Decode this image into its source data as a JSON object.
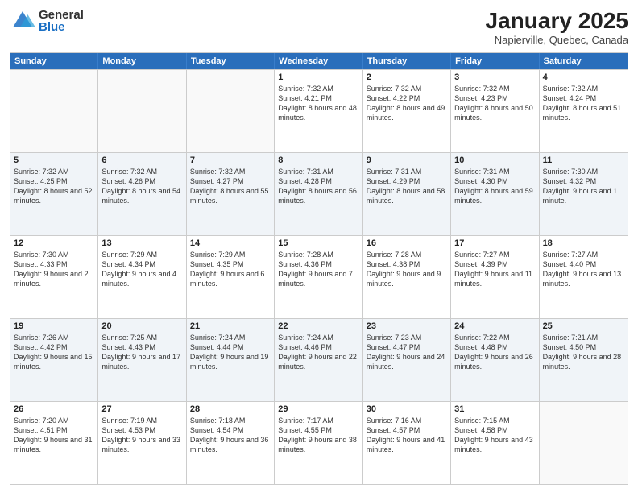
{
  "header": {
    "logo_general": "General",
    "logo_blue": "Blue",
    "month_title": "January 2025",
    "location": "Napierville, Quebec, Canada"
  },
  "days_of_week": [
    "Sunday",
    "Monday",
    "Tuesday",
    "Wednesday",
    "Thursday",
    "Friday",
    "Saturday"
  ],
  "weeks": [
    {
      "cells": [
        {
          "day": "",
          "sunrise": "",
          "sunset": "",
          "daylight": ""
        },
        {
          "day": "",
          "sunrise": "",
          "sunset": "",
          "daylight": ""
        },
        {
          "day": "",
          "sunrise": "",
          "sunset": "",
          "daylight": ""
        },
        {
          "day": "1",
          "sunrise": "Sunrise: 7:32 AM",
          "sunset": "Sunset: 4:21 PM",
          "daylight": "Daylight: 8 hours and 48 minutes."
        },
        {
          "day": "2",
          "sunrise": "Sunrise: 7:32 AM",
          "sunset": "Sunset: 4:22 PM",
          "daylight": "Daylight: 8 hours and 49 minutes."
        },
        {
          "day": "3",
          "sunrise": "Sunrise: 7:32 AM",
          "sunset": "Sunset: 4:23 PM",
          "daylight": "Daylight: 8 hours and 50 minutes."
        },
        {
          "day": "4",
          "sunrise": "Sunrise: 7:32 AM",
          "sunset": "Sunset: 4:24 PM",
          "daylight": "Daylight: 8 hours and 51 minutes."
        }
      ]
    },
    {
      "cells": [
        {
          "day": "5",
          "sunrise": "Sunrise: 7:32 AM",
          "sunset": "Sunset: 4:25 PM",
          "daylight": "Daylight: 8 hours and 52 minutes."
        },
        {
          "day": "6",
          "sunrise": "Sunrise: 7:32 AM",
          "sunset": "Sunset: 4:26 PM",
          "daylight": "Daylight: 8 hours and 54 minutes."
        },
        {
          "day": "7",
          "sunrise": "Sunrise: 7:32 AM",
          "sunset": "Sunset: 4:27 PM",
          "daylight": "Daylight: 8 hours and 55 minutes."
        },
        {
          "day": "8",
          "sunrise": "Sunrise: 7:31 AM",
          "sunset": "Sunset: 4:28 PM",
          "daylight": "Daylight: 8 hours and 56 minutes."
        },
        {
          "day": "9",
          "sunrise": "Sunrise: 7:31 AM",
          "sunset": "Sunset: 4:29 PM",
          "daylight": "Daylight: 8 hours and 58 minutes."
        },
        {
          "day": "10",
          "sunrise": "Sunrise: 7:31 AM",
          "sunset": "Sunset: 4:30 PM",
          "daylight": "Daylight: 8 hours and 59 minutes."
        },
        {
          "day": "11",
          "sunrise": "Sunrise: 7:30 AM",
          "sunset": "Sunset: 4:32 PM",
          "daylight": "Daylight: 9 hours and 1 minute."
        }
      ]
    },
    {
      "cells": [
        {
          "day": "12",
          "sunrise": "Sunrise: 7:30 AM",
          "sunset": "Sunset: 4:33 PM",
          "daylight": "Daylight: 9 hours and 2 minutes."
        },
        {
          "day": "13",
          "sunrise": "Sunrise: 7:29 AM",
          "sunset": "Sunset: 4:34 PM",
          "daylight": "Daylight: 9 hours and 4 minutes."
        },
        {
          "day": "14",
          "sunrise": "Sunrise: 7:29 AM",
          "sunset": "Sunset: 4:35 PM",
          "daylight": "Daylight: 9 hours and 6 minutes."
        },
        {
          "day": "15",
          "sunrise": "Sunrise: 7:28 AM",
          "sunset": "Sunset: 4:36 PM",
          "daylight": "Daylight: 9 hours and 7 minutes."
        },
        {
          "day": "16",
          "sunrise": "Sunrise: 7:28 AM",
          "sunset": "Sunset: 4:38 PM",
          "daylight": "Daylight: 9 hours and 9 minutes."
        },
        {
          "day": "17",
          "sunrise": "Sunrise: 7:27 AM",
          "sunset": "Sunset: 4:39 PM",
          "daylight": "Daylight: 9 hours and 11 minutes."
        },
        {
          "day": "18",
          "sunrise": "Sunrise: 7:27 AM",
          "sunset": "Sunset: 4:40 PM",
          "daylight": "Daylight: 9 hours and 13 minutes."
        }
      ]
    },
    {
      "cells": [
        {
          "day": "19",
          "sunrise": "Sunrise: 7:26 AM",
          "sunset": "Sunset: 4:42 PM",
          "daylight": "Daylight: 9 hours and 15 minutes."
        },
        {
          "day": "20",
          "sunrise": "Sunrise: 7:25 AM",
          "sunset": "Sunset: 4:43 PM",
          "daylight": "Daylight: 9 hours and 17 minutes."
        },
        {
          "day": "21",
          "sunrise": "Sunrise: 7:24 AM",
          "sunset": "Sunset: 4:44 PM",
          "daylight": "Daylight: 9 hours and 19 minutes."
        },
        {
          "day": "22",
          "sunrise": "Sunrise: 7:24 AM",
          "sunset": "Sunset: 4:46 PM",
          "daylight": "Daylight: 9 hours and 22 minutes."
        },
        {
          "day": "23",
          "sunrise": "Sunrise: 7:23 AM",
          "sunset": "Sunset: 4:47 PM",
          "daylight": "Daylight: 9 hours and 24 minutes."
        },
        {
          "day": "24",
          "sunrise": "Sunrise: 7:22 AM",
          "sunset": "Sunset: 4:48 PM",
          "daylight": "Daylight: 9 hours and 26 minutes."
        },
        {
          "day": "25",
          "sunrise": "Sunrise: 7:21 AM",
          "sunset": "Sunset: 4:50 PM",
          "daylight": "Daylight: 9 hours and 28 minutes."
        }
      ]
    },
    {
      "cells": [
        {
          "day": "26",
          "sunrise": "Sunrise: 7:20 AM",
          "sunset": "Sunset: 4:51 PM",
          "daylight": "Daylight: 9 hours and 31 minutes."
        },
        {
          "day": "27",
          "sunrise": "Sunrise: 7:19 AM",
          "sunset": "Sunset: 4:53 PM",
          "daylight": "Daylight: 9 hours and 33 minutes."
        },
        {
          "day": "28",
          "sunrise": "Sunrise: 7:18 AM",
          "sunset": "Sunset: 4:54 PM",
          "daylight": "Daylight: 9 hours and 36 minutes."
        },
        {
          "day": "29",
          "sunrise": "Sunrise: 7:17 AM",
          "sunset": "Sunset: 4:55 PM",
          "daylight": "Daylight: 9 hours and 38 minutes."
        },
        {
          "day": "30",
          "sunrise": "Sunrise: 7:16 AM",
          "sunset": "Sunset: 4:57 PM",
          "daylight": "Daylight: 9 hours and 41 minutes."
        },
        {
          "day": "31",
          "sunrise": "Sunrise: 7:15 AM",
          "sunset": "Sunset: 4:58 PM",
          "daylight": "Daylight: 9 hours and 43 minutes."
        },
        {
          "day": "",
          "sunrise": "",
          "sunset": "",
          "daylight": ""
        }
      ]
    }
  ]
}
